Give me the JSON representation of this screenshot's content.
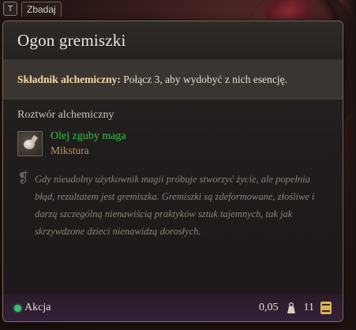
{
  "inspect": {
    "key": "T",
    "label": "Zbadaj"
  },
  "item": {
    "title": "Ogon gremiszki",
    "description_label": "Składnik alchemiczny:",
    "description_text": " Połącz 3, aby wydobyć z nich esencję.",
    "section_title": "Roztwór alchemiczny",
    "result_name": "Olej zguby maga",
    "result_type": "Mikstura",
    "flavor": "Gdy nieudolny użytkownik magii próbuje stworzyć życie, ale popełnia błąd, rezultatem jest gremiszka. Gremiszki są zdeformowane, złośliwe i darzą szczególną nienawiścią praktyków sztuk tajemnych, tak jak skrzywdzone dzieci nienawidzą dorosłych."
  },
  "footer": {
    "action_label": "Akcja",
    "weight": "0,05",
    "value": "11"
  },
  "colors": {
    "result_name": "#37c44a",
    "result_type": "#c5925a",
    "action_dot": "#36c06a",
    "border": "#7a6c58"
  },
  "icons": {
    "inspect_key": "key-t-icon",
    "result": "potion-flask-icon",
    "flavor": "quote-mark-icon",
    "weight": "weight-icon",
    "value": "gold-coin-icon"
  }
}
